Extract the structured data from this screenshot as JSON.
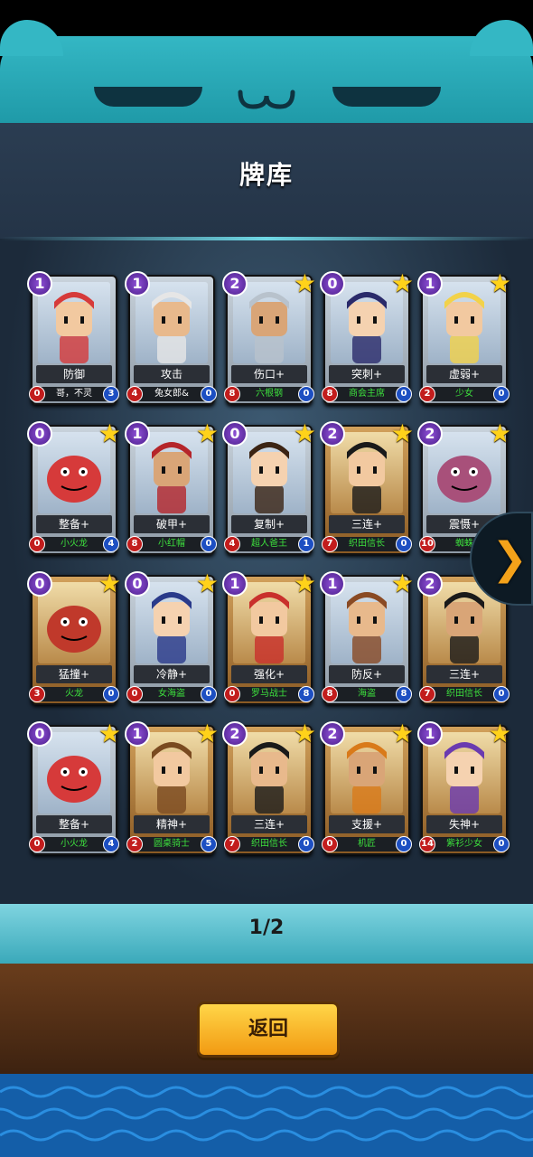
{
  "screen": {
    "title": "牌库",
    "pager": "1/2",
    "back_label": "返回"
  },
  "cards": [
    {
      "cost": "1",
      "name": "防御",
      "hero": "哥，不灵",
      "level": "0",
      "value": "3",
      "star": false,
      "frame": "silver",
      "hero_white": true,
      "portrait": "goblin-portrait"
    },
    {
      "cost": "1",
      "name": "攻击",
      "hero": "兔女郎&",
      "level": "4",
      "value": "0",
      "star": false,
      "frame": "silver",
      "hero_white": true,
      "portrait": "bunny-girl-portrait"
    },
    {
      "cost": "2",
      "name": "伤口+",
      "hero": "六根钢",
      "level": "8",
      "value": "0",
      "star": true,
      "frame": "silver",
      "hero_white": false,
      "portrait": "knight-portrait"
    },
    {
      "cost": "0",
      "name": "突刺+",
      "hero": "商会主席",
      "level": "8",
      "value": "0",
      "star": true,
      "frame": "silver",
      "hero_white": false,
      "portrait": "pirate-lady-portrait"
    },
    {
      "cost": "1",
      "name": "虚弱+",
      "hero": "少女",
      "level": "2",
      "value": "0",
      "star": true,
      "frame": "silver",
      "hero_white": false,
      "portrait": "elf-girl-portrait"
    },
    {
      "cost": "0",
      "name": "整备+",
      "hero": "小火龙",
      "level": "0",
      "value": "4",
      "star": true,
      "frame": "silver",
      "hero_white": false,
      "portrait": "red-dragon-portrait"
    },
    {
      "cost": "1",
      "name": "破甲+",
      "hero": "小红帽",
      "level": "8",
      "value": "0",
      "star": true,
      "frame": "silver",
      "hero_white": false,
      "portrait": "red-hood-portrait"
    },
    {
      "cost": "0",
      "name": "复制+",
      "hero": "超人爸王",
      "level": "4",
      "value": "1",
      "star": true,
      "frame": "silver",
      "hero_white": false,
      "portrait": "barbarian-portrait"
    },
    {
      "cost": "2",
      "name": "三连+",
      "hero": "织田信长",
      "level": "7",
      "value": "0",
      "star": true,
      "frame": "bronze",
      "hero_white": false,
      "portrait": "samurai-portrait"
    },
    {
      "cost": "2",
      "name": "震慑+",
      "hero": "蜘蛛",
      "level": "10",
      "value": "0",
      "star": true,
      "frame": "silver",
      "hero_white": false,
      "portrait": "spider-portrait"
    },
    {
      "cost": "0",
      "name": "猛撞+",
      "hero": "火龙",
      "level": "3",
      "value": "0",
      "star": true,
      "frame": "bronze",
      "hero_white": false,
      "portrait": "fire-dragon-portrait"
    },
    {
      "cost": "0",
      "name": "冷静+",
      "hero": "女海盗",
      "level": "0",
      "value": "0",
      "star": true,
      "frame": "silver",
      "hero_white": false,
      "portrait": "pirate-girl-portrait"
    },
    {
      "cost": "1",
      "name": "强化+",
      "hero": "罗马战士",
      "level": "0",
      "value": "8",
      "star": true,
      "frame": "bronze",
      "hero_white": false,
      "portrait": "spartan-portrait"
    },
    {
      "cost": "1",
      "name": "防反+",
      "hero": "海盗",
      "level": "8",
      "value": "8",
      "star": true,
      "frame": "silver",
      "hero_white": false,
      "portrait": "pirate-man-portrait"
    },
    {
      "cost": "2",
      "name": "三连+",
      "hero": "织田信长",
      "level": "7",
      "value": "0",
      "star": true,
      "frame": "bronze",
      "hero_white": false,
      "portrait": "samurai-portrait"
    },
    {
      "cost": "0",
      "name": "整备+",
      "hero": "小火龙",
      "level": "0",
      "value": "4",
      "star": true,
      "frame": "silver",
      "hero_white": false,
      "portrait": "red-dragon-portrait"
    },
    {
      "cost": "1",
      "name": "精神+",
      "hero": "圆桌骑士",
      "level": "2",
      "value": "5",
      "star": true,
      "frame": "bronze",
      "hero_white": false,
      "portrait": "noble-portrait"
    },
    {
      "cost": "2",
      "name": "三连+",
      "hero": "织田信长",
      "level": "7",
      "value": "0",
      "star": true,
      "frame": "bronze",
      "hero_white": false,
      "portrait": "samurai-portrait"
    },
    {
      "cost": "2",
      "name": "支援+",
      "hero": "机匠",
      "level": "0",
      "value": "0",
      "star": true,
      "frame": "bronze",
      "hero_white": false,
      "portrait": "mechanic-portrait"
    },
    {
      "cost": "1",
      "name": "失神+",
      "hero": "紫衫少女",
      "level": "14",
      "value": "0",
      "star": true,
      "frame": "bronze",
      "hero_white": false,
      "portrait": "mage-girl-portrait"
    }
  ]
}
